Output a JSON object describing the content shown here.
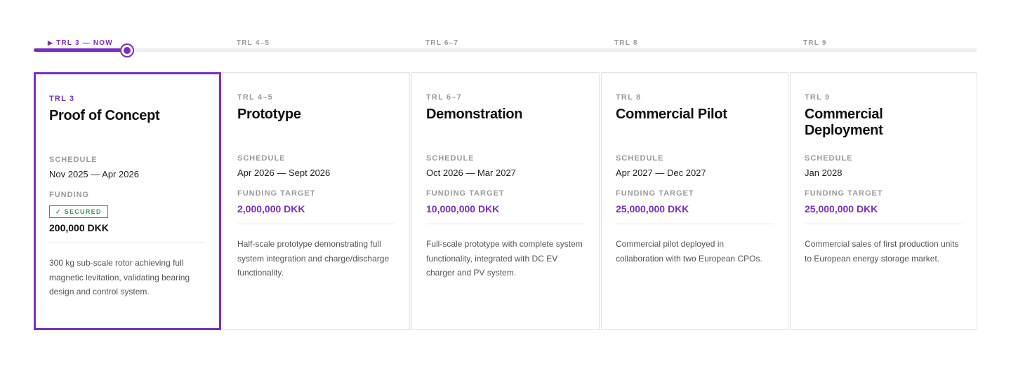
{
  "timeline": {
    "current_label": "TRL 3 — NOW",
    "current_arrow": "▶",
    "labels": [
      "TRL 4–5",
      "TRL 6–7",
      "TRL 8",
      "TRL 9"
    ]
  },
  "progress_fraction": 0.1,
  "colors": {
    "accent": "#7b2fbf",
    "secured": "#2e9e57",
    "border": "#e2e2e2"
  },
  "cards": [
    {
      "trl": "TRL 3",
      "title": "Proof of Concept",
      "schedule_label": "SCHEDULE",
      "schedule": "Nov 2025 — Apr 2026",
      "funding_label": "FUNDING",
      "badge": "✓ SECURED",
      "amount": "200,000 DKK",
      "description": "300 kg sub-scale rotor achieving full magnetic levitation, validating bearing design and control system."
    },
    {
      "trl": "TRL 4–5",
      "title": "Prototype",
      "schedule_label": "SCHEDULE",
      "schedule": "Apr 2026 — Sept 2026",
      "funding_label": "FUNDING TARGET",
      "amount": "2,000,000 DKK",
      "description": "Half-scale prototype demonstrating full system integration and charge/discharge functionality."
    },
    {
      "trl": "TRL 6–7",
      "title": "Demonstration",
      "schedule_label": "SCHEDULE",
      "schedule": "Oct 2026 — Mar 2027",
      "funding_label": "FUNDING TARGET",
      "amount": "10,000,000 DKK",
      "description": "Full-scale prototype with complete system functionality, integrated with DC EV charger and PV system."
    },
    {
      "trl": "TRL 8",
      "title": "Commercial Pilot",
      "schedule_label": "SCHEDULE",
      "schedule": "Apr 2027 — Dec 2027",
      "funding_label": "FUNDING TARGET",
      "amount": "25,000,000 DKK",
      "description": "Commercial pilot deployed in collaboration with two European CPOs."
    },
    {
      "trl": "TRL 9",
      "title": "Commercial Deployment",
      "schedule_label": "SCHEDULE",
      "schedule": "Jan 2028",
      "funding_label": "FUNDING TARGET",
      "amount": "25,000,000 DKK",
      "description": "Commercial sales of first production units to European energy storage market."
    }
  ]
}
